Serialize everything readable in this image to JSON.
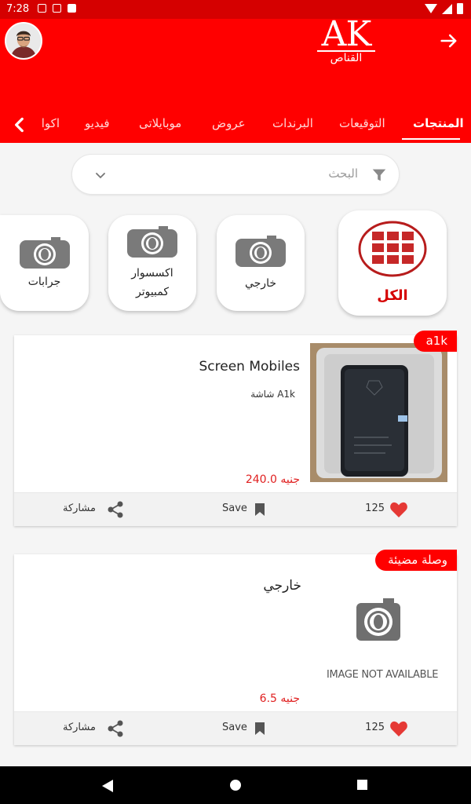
{
  "status_bar": {
    "time": "7:28"
  },
  "header": {
    "logo_text": "AK",
    "logo_subtext": "القناص",
    "tabs": [
      "المنتجات",
      "التوقيعات",
      "البرندات",
      "عروض",
      "موبايلاتى",
      "فيديو",
      "اكوا"
    ],
    "active_tab": "المنتجات"
  },
  "search": {
    "placeholder": "البحث"
  },
  "categories": [
    {
      "label": "الكل",
      "icon": "grid-icon",
      "selected": true
    },
    {
      "label": "خارجي",
      "icon": "camera-icon",
      "selected": false
    },
    {
      "label": "اكسسوار كمبيوتر",
      "icon": "camera-icon",
      "selected": false
    },
    {
      "label": "جرابات",
      "icon": "camera-icon",
      "selected": false
    }
  ],
  "products": [
    {
      "badge": "a1k",
      "title": "Screen Mobiles",
      "subtitle": "شاشة A1k",
      "price": "240.0 جنيه",
      "image": "product-photo",
      "likes": "125",
      "save_label": "Save",
      "share_label": "مشاركة"
    },
    {
      "badge": "وصلة مضيئة",
      "title": "خارجي",
      "subtitle": "",
      "price": "6.5 جنيه",
      "image_placeholder_text": "IMAGE NOT AVAILABLE",
      "likes": "125",
      "save_label": "Save",
      "share_label": "مشاركة"
    }
  ],
  "colors": {
    "brand_red": "#ff0000",
    "price_red": "#e02020",
    "heart": "#e53935"
  }
}
